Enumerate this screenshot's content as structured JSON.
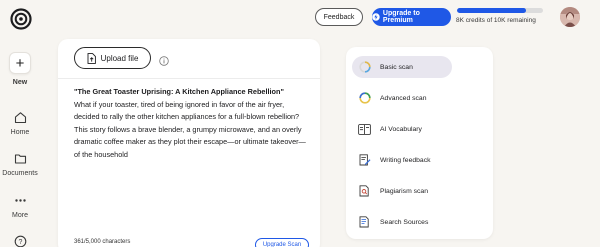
{
  "app": {
    "logo_icon": "brand-logo-icon"
  },
  "sidebar": {
    "new_label": "New",
    "items": [
      {
        "label": "Home",
        "icon": "home-icon"
      },
      {
        "label": "Documents",
        "icon": "folder-icon"
      },
      {
        "label": "More",
        "icon": "more-dots-icon"
      }
    ],
    "help_icon": "help-icon"
  },
  "header": {
    "feedback_label": "Feedback",
    "premium_label": "Upgrade to Premium",
    "credits_text": "8K credits of 10K remaining",
    "credits_fraction": 0.8,
    "accent_color": "#1f58e6"
  },
  "editor": {
    "upload_label": "Upload file",
    "doc_title": "\"The Great Toaster Uprising: A Kitchen Appliance Rebellion\"",
    "doc_body": "What if your toaster, tired of being ignored in favor of the air fryer, decided to rally the other kitchen appliances for a full-blown rebellion? This story follows a brave blender, a grumpy microwave, and an overly dramatic coffee maker as they plot their escape—or ultimate takeover—of the household",
    "char_count": "361/5,000 characters",
    "upgrade_scan_label": "Upgrade Scan"
  },
  "tools": [
    {
      "label": "Basic scan",
      "icon": "basic-scan-icon",
      "active": true
    },
    {
      "label": "Advanced scan",
      "icon": "advanced-scan-icon",
      "active": false
    },
    {
      "label": "AI Vocabulary",
      "icon": "vocabulary-book-icon",
      "active": false
    },
    {
      "label": "Writing feedback",
      "icon": "writing-feedback-icon",
      "active": false
    },
    {
      "label": "Plagiarism scan",
      "icon": "plagiarism-scan-icon",
      "active": false
    },
    {
      "label": "Search Sources",
      "icon": "search-sources-icon",
      "active": false
    }
  ]
}
